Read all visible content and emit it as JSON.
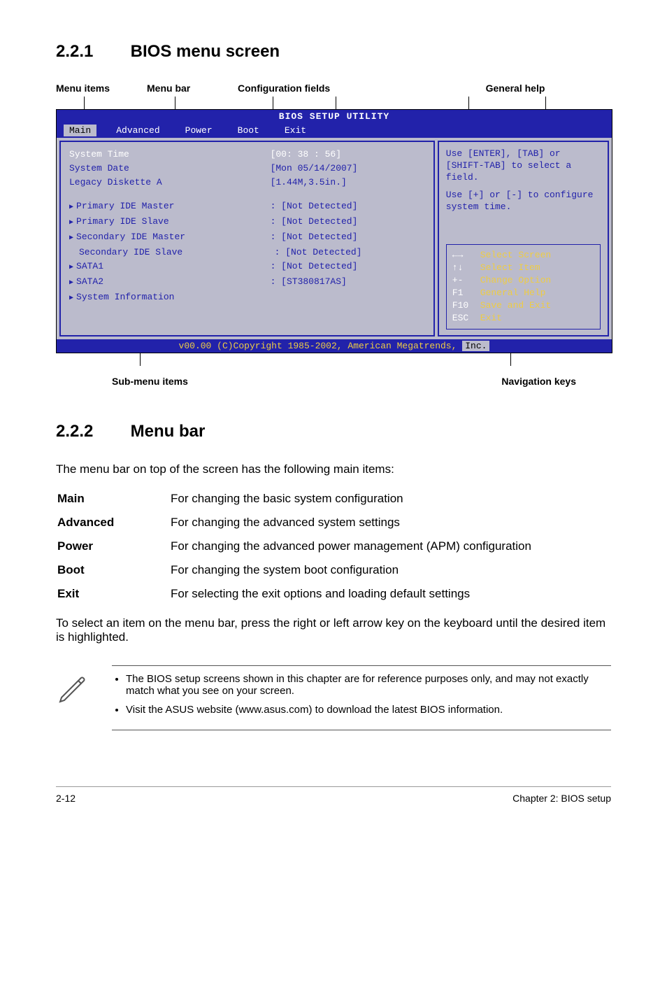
{
  "section1": {
    "num": "2.2.1",
    "title": "BIOS menu screen"
  },
  "labels": {
    "menu_items": "Menu items",
    "menu_bar": "Menu bar",
    "config_fields": "Configuration fields",
    "general_help": "General help",
    "sub_menu_items": "Sub-menu items",
    "nav_keys": "Navigation keys"
  },
  "bios": {
    "title": "BIOS SETUP UTILITY",
    "menu": [
      "Main",
      "Advanced",
      "Power",
      "Boot",
      "Exit"
    ],
    "rows": [
      {
        "label": "System Time",
        "value": "[00: 38 : 56]",
        "sel": true
      },
      {
        "label": "System Date",
        "value": "[Mon 05/14/2007]"
      },
      {
        "label": "Legacy Diskette A",
        "value": "[1.44M,3.5in.]"
      }
    ],
    "rows2": [
      {
        "label": "Primary IDE Master",
        "value": ": [Not Detected]",
        "tri": true
      },
      {
        "label": "Primary IDE Slave",
        "value": ": [Not Detected]",
        "tri": true
      },
      {
        "label": "Secondary IDE Master",
        "value": ": [Not Detected]",
        "tri": true
      },
      {
        "label": "Secondary IDE Slave",
        "value": ": [Not Detected]"
      },
      {
        "label": "SATA1",
        "value": ": [Not Detected]",
        "tri": true
      },
      {
        "label": "SATA2",
        "value": ": [ST380817AS]",
        "tri": true
      },
      {
        "label": "System Information",
        "value": "",
        "tri": true
      }
    ],
    "help": "Use [ENTER], [TAB] or [SHIFT-TAB] to select a field.",
    "help2": "Use [+] or [-] to configure system time.",
    "nav": [
      {
        "key": "←→",
        "desc": "Select Screen"
      },
      {
        "key": "↑↓",
        "desc": "Select Item"
      },
      {
        "key": "+-",
        "desc": "Change Option"
      },
      {
        "key": "F1",
        "desc": "General Help"
      },
      {
        "key": "F10",
        "desc": "Save and Exit"
      },
      {
        "key": "ESC",
        "desc": "Exit"
      }
    ],
    "footer_pre": "v00.00 (C)Copyright 1985-2002, American Megatrends, ",
    "footer_inc": "Inc."
  },
  "section2": {
    "num": "2.2.2",
    "title": "Menu bar"
  },
  "body_intro": "The menu bar on top of the screen has the following main items:",
  "defs": [
    {
      "term": "Main",
      "desc": "For changing the basic system configuration"
    },
    {
      "term": "Advanced",
      "desc": "For changing the advanced system settings"
    },
    {
      "term": "Power",
      "desc": "For changing the advanced power management (APM) configuration"
    },
    {
      "term": "Boot",
      "desc": "For changing the system boot configuration"
    },
    {
      "term": "Exit",
      "desc": "For selecting the exit options and loading default settings"
    }
  ],
  "body_outro": "To select an item on the menu bar, press the right or left arrow key on the keyboard until the desired item is highlighted.",
  "notes": [
    "The BIOS setup screens shown in this chapter are for reference purposes only, and may not exactly match what you see on your screen.",
    "Visit the ASUS website (www.asus.com) to download the latest BIOS information."
  ],
  "footer": {
    "left": "2-12",
    "right": "Chapter 2: BIOS setup"
  }
}
